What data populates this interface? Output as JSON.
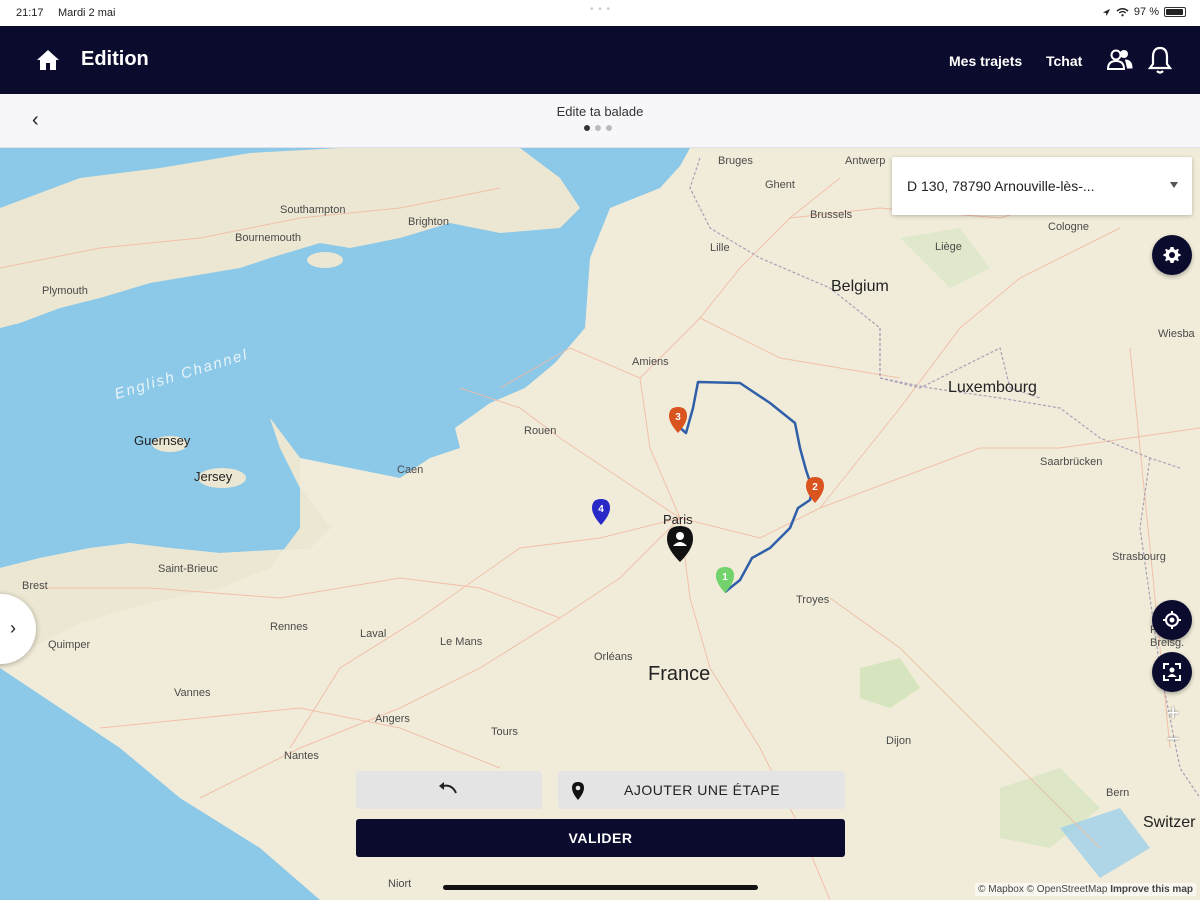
{
  "status_bar": {
    "time": "21:17",
    "date": "Mardi 2 mai",
    "battery": "97 %",
    "battery_level": 0.97
  },
  "header": {
    "title": "Edition",
    "nav_trips": "Mes trajets",
    "nav_chat": "Tchat"
  },
  "subheader": {
    "title": "Edite ta balade",
    "page_count": 3,
    "active_page": 1
  },
  "map": {
    "address": "D 130, 78790 Arnouville-lès-...",
    "countries": [
      "Belgium",
      "Luxembourg",
      "France",
      "Switzer"
    ],
    "sea": "English Channel",
    "places": [
      "Bruges",
      "Antwerp",
      "Ghent",
      "Brussels",
      "Lille",
      "Liège",
      "Cologne",
      "Wiesba",
      "Southampton",
      "Brighton",
      "Bournemouth",
      "Plymouth",
      "Guernsey",
      "Jersey",
      "Amiens",
      "Rouen",
      "Caen",
      "Paris",
      "Saarbrücken",
      "Strasbourg",
      "Saint-Brieuc",
      "Brest",
      "Rennes",
      "Laval",
      "Le Mans",
      "Orléans",
      "Troyes",
      "Quimper",
      "Vannes",
      "Angers",
      "Tours",
      "Nantes",
      "Dijon",
      "Bern",
      "Freib. Breisg.",
      "Niort"
    ],
    "markers": [
      "1",
      "2",
      "3",
      "4"
    ],
    "attribution_mapbox": "© Mapbox",
    "attribution_osm": "© OpenStreetMap",
    "attribution_improve": "Improve this map",
    "zoom_in": "+",
    "zoom_out": "−"
  },
  "actions": {
    "add_step": "AJOUTER UNE ÉTAPE",
    "validate": "VALIDER"
  },
  "colors": {
    "primary": "#0b0b2e",
    "route": "#2f5fa8",
    "marker_orange": "#d9541e",
    "marker_green": "#72d36d",
    "marker_blue": "#2929c8",
    "water": "#8cc8e8",
    "land": "#f1ecd9"
  }
}
